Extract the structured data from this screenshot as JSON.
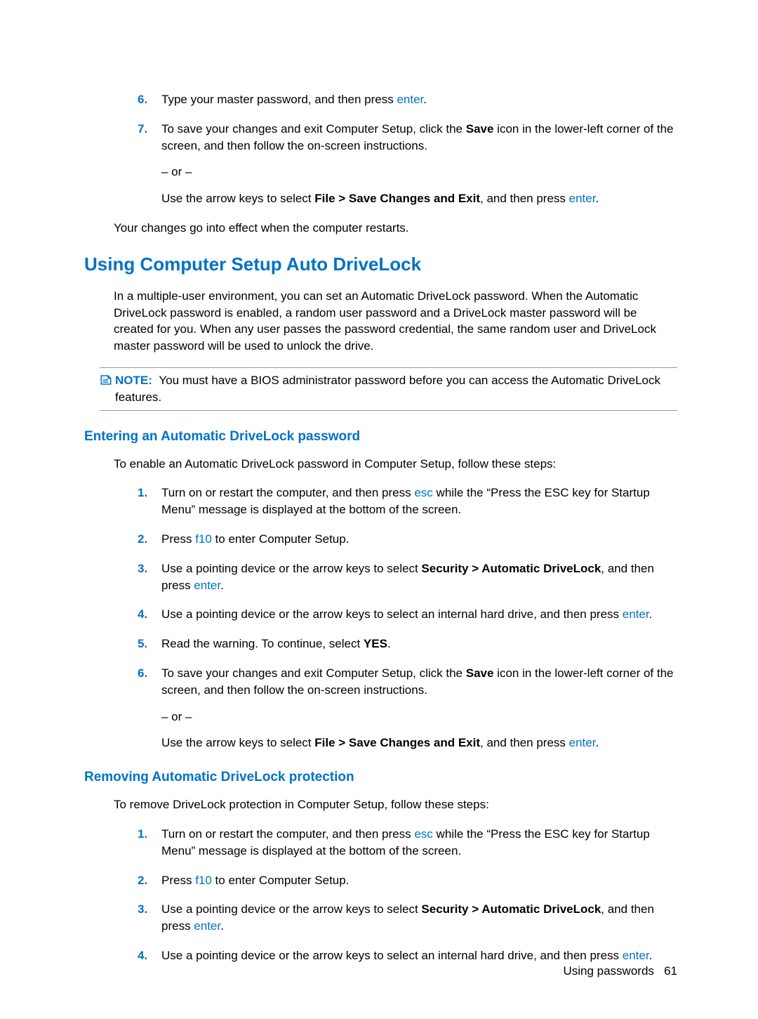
{
  "top_steps": {
    "s6_num": "6.",
    "s6_a": "Type your master password, and then press ",
    "s6_key": "enter",
    "s6_b": ".",
    "s7_num": "7.",
    "s7_a": "To save your changes and exit Computer Setup, click the ",
    "s7_bold": "Save",
    "s7_b": " icon in the lower-left corner of the screen, and then follow the on-screen instructions.",
    "s7_or": "– or –",
    "s7_c": "Use the arrow keys to select ",
    "s7_bold2": "File > Save Changes and Exit",
    "s7_d": ", and then press ",
    "s7_key": "enter",
    "s7_e": "."
  },
  "restart_para": "Your changes go into effect when the computer restarts.",
  "section_heading": "Using Computer Setup Auto DriveLock",
  "section_intro": "In a multiple-user environment, you can set an Automatic DriveLock password. When the Automatic DriveLock password is enabled, a random user password and a DriveLock master password will be created for you. When any user passes the password credential, the same random user and DriveLock master password will be used to unlock the drive.",
  "note": {
    "label": "NOTE:",
    "text": "You must have a BIOS administrator password before you can access the Automatic DriveLock features."
  },
  "sub1_heading": "Entering an Automatic DriveLock password",
  "sub1_intro": "To enable an Automatic DriveLock password in Computer Setup, follow these steps:",
  "sub1_steps": {
    "n1": "1.",
    "t1a": "Turn on or restart the computer, and then press ",
    "t1key": "esc",
    "t1b": " while the “Press the ESC key for Startup Menu” message is displayed at the bottom of the screen.",
    "n2": "2.",
    "t2a": "Press ",
    "t2key": "f10",
    "t2b": " to enter Computer Setup.",
    "n3": "3.",
    "t3a": "Use a pointing device or the arrow keys to select ",
    "t3bold": "Security > Automatic DriveLock",
    "t3b": ", and then press ",
    "t3key": "enter",
    "t3c": ".",
    "n4": "4.",
    "t4a": "Use a pointing device or the arrow keys to select an internal hard drive, and then press ",
    "t4key": "enter",
    "t4b": ".",
    "n5": "5.",
    "t5a": "Read the warning. To continue, select ",
    "t5bold": "YES",
    "t5b": ".",
    "n6": "6.",
    "t6a": "To save your changes and exit Computer Setup, click the ",
    "t6bold": "Save",
    "t6b": " icon in the lower-left corner of the screen, and then follow the on-screen instructions.",
    "t6or": "– or –",
    "t6c": "Use the arrow keys to select ",
    "t6bold2": "File > Save Changes and Exit",
    "t6d": ", and then press ",
    "t6key": "enter",
    "t6e": "."
  },
  "sub2_heading": "Removing Automatic DriveLock protection",
  "sub2_intro": "To remove DriveLock protection in Computer Setup, follow these steps:",
  "sub2_steps": {
    "n1": "1.",
    "t1a": "Turn on or restart the computer, and then press ",
    "t1key": "esc",
    "t1b": " while the “Press the ESC key for Startup Menu” message is displayed at the bottom of the screen.",
    "n2": "2.",
    "t2a": "Press ",
    "t2key": "f10",
    "t2b": " to enter Computer Setup.",
    "n3": "3.",
    "t3a": "Use a pointing device or the arrow keys to select ",
    "t3bold": "Security > Automatic DriveLock",
    "t3b": ", and then press ",
    "t3key": "enter",
    "t3c": ".",
    "n4": "4.",
    "t4a": "Use a pointing device or the arrow keys to select an internal hard drive, and then press ",
    "t4key": "enter",
    "t4b": "."
  },
  "footer_text": "Using passwords",
  "footer_page": "61"
}
